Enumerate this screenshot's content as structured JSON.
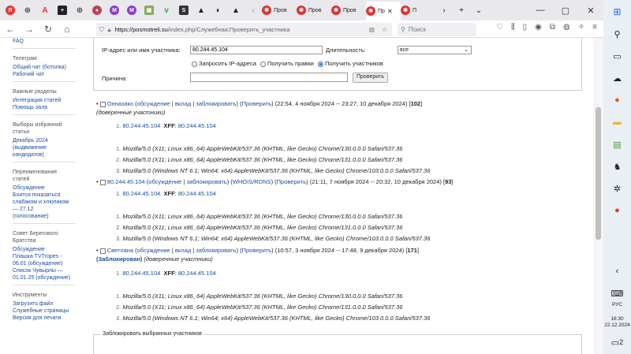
{
  "browser": {
    "tabs": [
      {
        "icon": "yandex-icon",
        "label": ""
      },
      {
        "icon": "globe-icon",
        "label": ""
      },
      {
        "icon": "a-icon",
        "label": ""
      },
      {
        "icon": "plus-square-icon",
        "label": ""
      },
      {
        "icon": "globe-icon",
        "label": ""
      },
      {
        "icon": "photo-icon",
        "label": ""
      },
      {
        "icon": "m-icon",
        "label": ""
      },
      {
        "icon": "m-icon",
        "label": ""
      },
      {
        "icon": "image-icon",
        "label": ""
      },
      {
        "icon": "v-icon",
        "label": ""
      },
      {
        "icon": "s-icon",
        "label": ""
      },
      {
        "icon": "warning-icon",
        "label": ""
      },
      {
        "icon": "half-circle-icon",
        "label": ""
      },
      {
        "icon": "warning-icon",
        "label": ""
      }
    ],
    "named_tabs": [
      {
        "label": "Пров"
      },
      {
        "label": "Пров"
      },
      {
        "label": "Пров"
      },
      {
        "label": "Пр"
      },
      {
        "label": "П"
      }
    ],
    "url_host": "https://posmotreli.su",
    "url_path": "/index.php/Служебная:Проверить_участника",
    "search_placeholder": "Поиск",
    "window_controls": {
      "min": "—",
      "max": "▢",
      "close": "✕"
    }
  },
  "sidebar": {
    "top_link": "FAQ",
    "sections": [
      {
        "title": "Телеграм",
        "links": [
          "Общий чат (ботолка)",
          "Рабочий чат"
        ]
      },
      {
        "title": "Важные разделы",
        "links": [
          "Интеграция статей",
          "Помощь зала"
        ]
      },
      {
        "title": "Выборы избранной статьи",
        "links": [
          "Декабрь 2024 (выдвижение кандидатов)"
        ]
      },
      {
        "title": "Переименование статей",
        "links": [
          "Обсуждение",
          "Боится показаться слабаком и хлюпиком — 27.12 (голосование)"
        ]
      },
      {
        "title": "Совет Берегового Братства",
        "links": [
          "Обсуждение",
          "Плашка TVTropes - 06.01 (обсуждение)",
          "Список Чувырлы — 01.01.25 (обсуждение)"
        ]
      },
      {
        "title": "Инструменты",
        "links": [
          "Загрузить файл",
          "Служебные страницы",
          "Версия для печати"
        ]
      }
    ]
  },
  "form": {
    "ip_label": "IP-адрес или имя участника:",
    "ip_value": "80.244.45.104",
    "duration_label": "Длительность:",
    "duration_value": "все",
    "radio1": "Запросить IP-адреса",
    "radio2": "Получить правки",
    "radio3": "Получить участников",
    "reason_label": "Причина:",
    "reason_value": "",
    "submit": "Проверить"
  },
  "entries": [
    {
      "user": "Онназако",
      "talk": "обсуждение",
      "contribs": "вклад",
      "block": "заблокировать",
      "check": "Проверить",
      "range": "(22:54, 4 ноября 2024 -- 23:27, 10 декабря 2024)",
      "count": "102",
      "status": "(доверенные участники)",
      "ips": [
        {
          "ip": "80.244.45.104",
          "xff_label": "XFF",
          "xff": "80.244.45.104"
        }
      ],
      "uas": [
        "Mozilla/5.0 (X11; Linux x86_64) AppleWebKit/537.36 (KHTML, like Gecko) Chrome/130.0.0.0 Safari/537.36",
        "Mozilla/5.0 (X11; Linux x86_64) AppleWebKit/537.36 (KHTML, like Gecko) Chrome/131.0.0.0 Safari/537.36",
        "Mozilla/5.0 (Windows NT 6.1; Win64; x64) AppleWebKit/537.36 (KHTML, like Gecko) Chrome/103.0.0.0 Safari/537.36"
      ]
    },
    {
      "user": "80.244.45.104",
      "talk": "обсуждение",
      "block": "заблокировать",
      "whois": "WHOIS/RDNS",
      "check": "Проверить",
      "range": "(21:11, 7 ноября 2024 -- 20:32, 10 декабря 2024)",
      "count": "93",
      "ips": [
        {
          "ip": "80.244.45.104",
          "xff_label": "XFF",
          "xff": "80.244.45.104"
        }
      ],
      "uas": [
        "Mozilla/5.0 (X11; Linux x86_64) AppleWebKit/537.36 (KHTML, like Gecko) Chrome/130.0.0.0 Safari/537.36",
        "Mozilla/5.0 (X11; Linux x86_64) AppleWebKit/537.36 (KHTML, like Gecko) Chrome/131.0.0.0 Safari/537.36",
        "Mozilla/5.0 (Windows NT 6.1; Win64; x64) AppleWebKit/537.36 (KHTML, like Gecko) Chrome/103.0.0.0 Safari/537.36"
      ]
    },
    {
      "user": "Светлана",
      "talk": "обсуждение",
      "contribs": "вклад",
      "block": "заблокировать",
      "check": "Проверить",
      "range": "(10:57, 3 ноября 2024 -- 17:48, 9 декабря 2024)",
      "count": "171",
      "blocked": "(Заблокирован)",
      "status": "(доверенные участники)",
      "ips": [
        {
          "ip": "80.244.45.104",
          "xff_label": "XFF",
          "xff": "80.244.45.104"
        }
      ],
      "uas": [
        "Mozilla/5.0 (X11; Linux x86_64) AppleWebKit/537.36 (KHTML, like Gecko) Chrome/130.0.0.0 Safari/537.36",
        "Mozilla/5.0 (X11; Linux x86_64) AppleWebKit/537.36 (KHTML, like Gecko) Chrome/131.0.0.0 Safari/537.36",
        "Mozilla/5.0 (Windows NT 6.1; Win64; x64) AppleWebKit/537.36 (KHTML, like Gecko) Chrome/103.0.0.0 Safari/537.36"
      ]
    }
  ],
  "block_section": {
    "legend": "Заблокировать выбранных участников"
  },
  "taskbar": {
    "lang": "РУС",
    "time": "16:30",
    "date": "22.12.2024",
    "notif": "2"
  }
}
